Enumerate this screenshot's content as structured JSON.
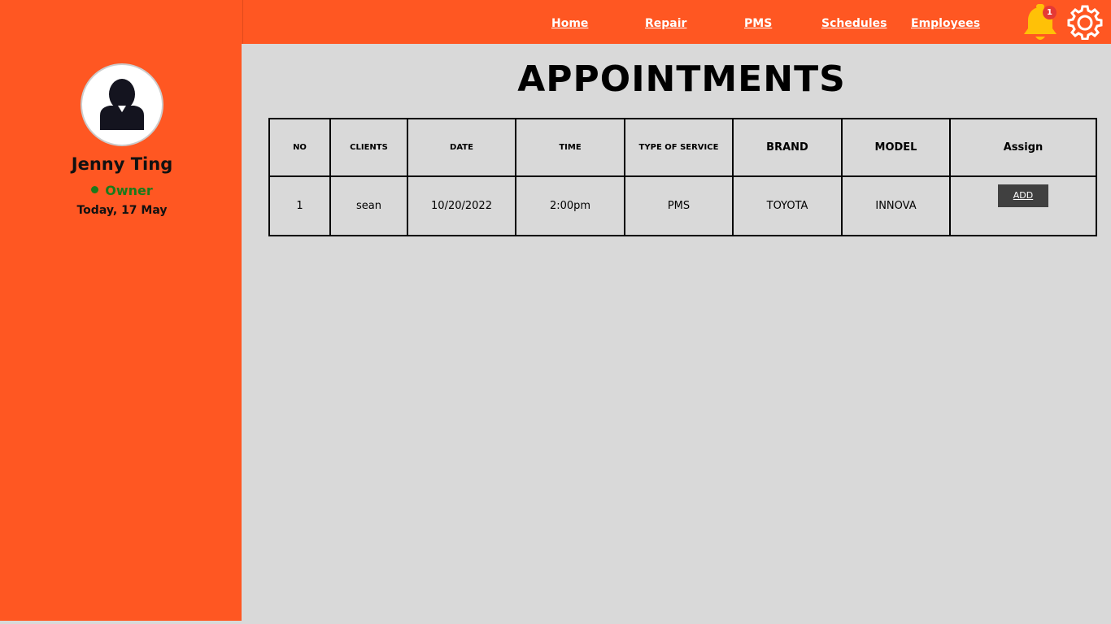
{
  "nav": {
    "links": [
      "Home",
      "Repair",
      "PMS",
      "Schedules",
      "Employees"
    ],
    "notification_count": "1",
    "icons": {
      "notifications": "bell-icon",
      "settings": "gear-icon"
    }
  },
  "profile": {
    "avatar_icon": "user-avatar-icon",
    "name": "Jenny Ting",
    "role": "Owner",
    "date": "Today, 17 May"
  },
  "main": {
    "title": "APPOINTMENTS",
    "columns": [
      "NO",
      "CLIENTS",
      "DATE",
      "TIME",
      "TYPE OF SERVICE",
      "BRAND",
      "MODEL",
      "Assign"
    ],
    "rows": [
      {
        "no": "1",
        "client": "sean",
        "date": "10/20/2022",
        "time": "2:00pm",
        "service": "PMS",
        "brand": "TOYOTA",
        "model": "INNOVA",
        "action": "ADD"
      }
    ]
  },
  "colors": {
    "accent": "#ff5722",
    "background": "#d9d9d9",
    "status_online": "#1b7a1b",
    "bell": "#ffc107",
    "badge": "#e53935",
    "button": "#404040"
  }
}
